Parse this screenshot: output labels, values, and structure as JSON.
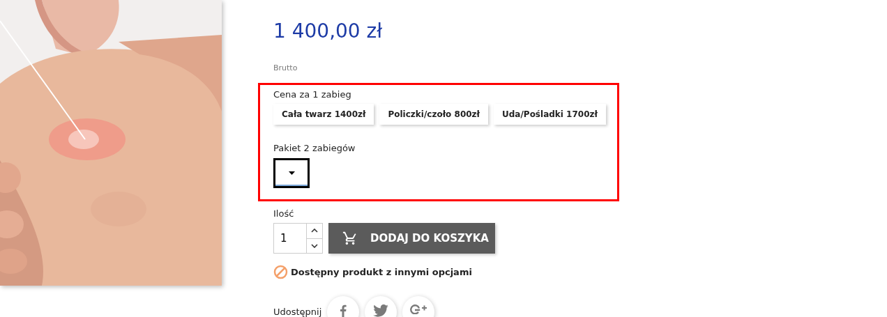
{
  "price": "1 400,00 zł",
  "price_note": "Brutto",
  "option_groups": [
    {
      "label": "Cena za 1 zabieg",
      "kind": "radio",
      "options": [
        {
          "label": "Cała twarz 1400zł",
          "selected": false
        },
        {
          "label": "Policzki/czoło 800zł",
          "selected": false
        },
        {
          "label": "Uda/Pośladki 1700zł",
          "selected": false
        }
      ]
    },
    {
      "label": "Pakiet 2 zabiegów",
      "kind": "select"
    }
  ],
  "quantity": {
    "label": "Ilość",
    "value": "1"
  },
  "add_to_cart": "DODAJ DO KOSZYKA",
  "availability": "Dostępny produkt z innymi opcjami",
  "share": {
    "label": "Udostępnij"
  }
}
